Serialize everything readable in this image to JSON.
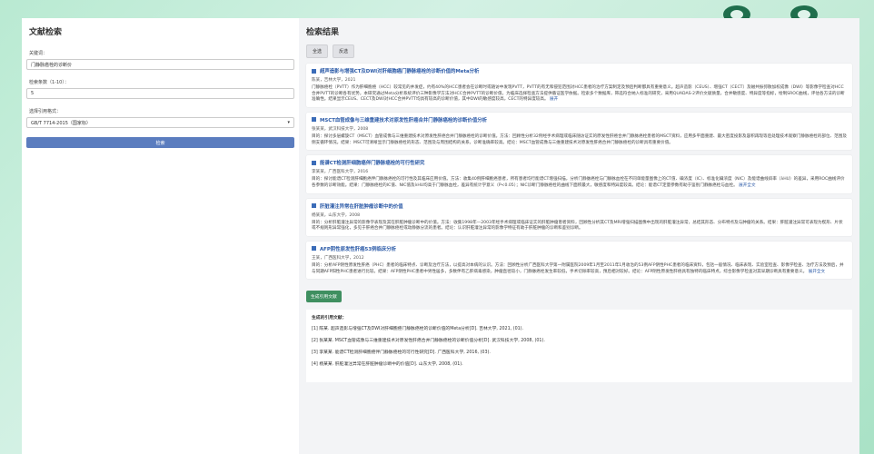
{
  "left": {
    "title": "文献检索",
    "keyword_label": "关键词：",
    "keyword_value": "门静脉癌栓的诊断价",
    "count_label": "检索条数（1-10）：",
    "count_value": "5",
    "style_label": "选择引用格式：",
    "style_value": "GB/T 7714-2015（国家标）",
    "search_label": "检索"
  },
  "right": {
    "title": "检索结果",
    "sort_buttons": [
      "全选",
      "反选"
    ],
    "results": [
      {
        "title": "超声造影与增强CT及DWI对肝细胞癌门静脉癌栓的诊断价值的Meta分析",
        "meta": "陈某，吉林大学，2021",
        "abstract": "门静脉癌栓（PVTT）作为肝细胞癌（HCC）较常见的并发症，约有40%的HCC患者会在诊断时或随访中发现PVTT，PVTT的有无和侵犯范围对HCC患者的治疗方案制定及预后判断都具有重要意义。超声造影（CEUS）、增强CT（CECT）及磁共振弥散加权成像（DWI）等影像学检查对HCC合并PVTT的诊断各有优势，本研究通过Meta分析系统评价三种影像学方法对HCC合并PVTT的诊断价值，为临床选择检查方法提供循证医学依据。检索多个数据库，筛选符合纳入标准的研究，采用QUADAS-2评价文献质量，合并敏感度、特异度等指标，绘制SROC曲线，评估各方法的诊断准确性。结果显示CEUS、CECT及DWI对HCC合并PVTT均具有较高的诊断价值，其中DWI的敏感度较高，CECT的特异度较高。",
        "more": "展开"
      },
      {
        "title": "MSCT血管成像与三维重建技术对原发性肝癌合并门静脉癌栓的诊断价值分析",
        "meta": "张某某，武汉科技大学，2008",
        "abstract": "目的：探讨多层螺旋CT（MSCT）血管成像与三维重建技术对原发性肝癌合并门静脉癌栓的诊断价值。方法：回顾性分析32例经手术病理或临床随访证实的原发性肝癌合并门静脉癌栓患者的MSCT资料，应用多平面重建、最大密度投影及容积再现等后处理技术观察门静脉癌栓的部位、范围及侧支循环情况。结果：MSCT可清晰显示门静脉癌栓的形态、范围及与周围结构的关系，诊断准确率较高。结论：MSCT血管成像与三维重建技术对原发性肝癌合并门静脉癌栓的诊断具有重要价值。",
        "more": ""
      },
      {
        "title": "能谱CT检测肝细胞癌伴门静脉癌栓的可行性研究",
        "meta": "李某某，广西医科大学，2016",
        "abstract": "目的：探讨能谱CT检测肝细胞癌伴门静脉癌栓的可行性及其临床应用价值。方法：收集40例肝细胞癌患者，所有患者均行能谱CT增强扫描，分析门静脉癌栓与门静脉血栓在不同单能量图像上的CT值、碘浓度（IC）、标准化碘浓度（NIC）及能谱曲线斜率（λHU）的差异，采用ROC曲线评价各参数的诊断效能。结果：门静脉癌栓的IC值、NIC值及λHU均高于门静脉血栓，差异有统计学意义（P<0.05）；NIC诊断门静脉癌栓的曲线下面积最大，敏感度和特异度较高。结论：能谱CT定量参数有助于鉴别门静脉癌栓与血栓。",
        "more": "展开全文"
      },
      {
        "title": "肝脏灌注异常在肝脏肿瘤诊断中的价值",
        "meta": "杨某某，山东大学，2008",
        "abstract": "目的：分析肝脏灌注异常的影像学表现及其在肝脏肿瘤诊断中的价值。方法：收集1998年—2003年经手术病理或临床证实的肝脏肿瘤患者资料，回顾性分析其CT及MRI增强扫描图像中出现的肝脏灌注异常，总结其形态、分布特点及与肿瘤的关系。结果：肝脏灌注异常可表现为楔形、片状或不规则形异常强化，多见于肝癌合并门静脉癌栓或动静脉分流的患者。结论：认识肝脏灌注异常的影像学特征有助于肝脏肿瘤的诊断和鉴别诊断。",
        "more": ""
      },
      {
        "title": "AFP阴性原发性肝癌53例临床分析",
        "meta": "王某，广西医科大学，2012",
        "abstract": "目的：分析AFP阴性原发性肝癌（PHC）患者的临床特点、诊断及治疗方法，以提高对本病的认识。方法：回顾性分析广西医科大学第一附属医院2009年1月至2011年1月收治的53例AFP阴性PHC患者的临床资料，包括一般情况、临床表现、实验室检查、影像学检查、治疗方法及预后，并与同期AFP阳性PHC患者进行比较。结果：AFP阴性PHC患者中男性居多，多数伴有乙肝病毒感染，肿瘤直径较小，门静脉癌栓发生率较低，手术切除率较高，预后相对较好。结论：AFP阴性原发性肝癌具有独特的临床特点，综合影像学检查对其早期诊断具有重要意义。",
        "more": "展开全文"
      }
    ],
    "generate_label": "生成引用文献",
    "refs_title": "生成的引用文献：",
    "refs": [
      "[1] 陈某. 超声造影与增强CT及DWI对肝细胞癌门静脉癌栓的诊断价值的Meta分析[D]. 吉林大学, 2021, (01).",
      "[2] 张某某. MSCT血管成像与三维重建技术对原发性肝癌合并门静脉癌栓的诊断价值分析[D]. 武汉科技大学, 2008, (01).",
      "[3] 李某某. 能谱CT检测肝细胞癌伴门静脉癌栓的可行性研究[D]. 广西医科大学, 2016, (03).",
      "[4] 杨某某. 肝脏灌注异常在肝脏肿瘤诊断中的价值[D]. 山东大学, 2008, (01)."
    ]
  }
}
